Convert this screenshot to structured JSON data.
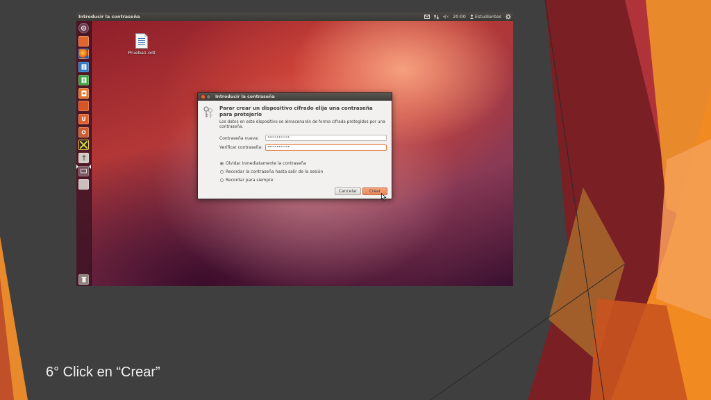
{
  "caption": "6° Click en “Crear”",
  "colors": {
    "accent": "#e98a5e",
    "slide_bg": "#3f3f3f",
    "orange": "#f0821e",
    "red": "#a52a2a"
  },
  "screen": {
    "topbar": {
      "title": "Introducir la contraseña",
      "time": "20:00",
      "user": "Estudiantes",
      "icons": [
        "mail-icon",
        "network-icon",
        "volume-icon",
        "user-icon",
        "gear-icon"
      ]
    },
    "launcher": {
      "items": [
        "dash-icon",
        "files-icon",
        "firefox-icon",
        "writer-icon",
        "calc-icon",
        "impress-icon",
        "software-center-icon",
        "ubuntu-one-icon",
        "settings-icon",
        "game-icon",
        "terminal-icon",
        "monitor-icon",
        "removable-drive-icon",
        "trash-icon"
      ]
    },
    "desktop_file": {
      "name": "Prueba1.odt",
      "icon": "document-icon"
    },
    "dialog": {
      "title": "Introducir la contraseña",
      "heading": "Parar crear un dispositivo cifrado elija una contraseña para protejerlo",
      "description": "Los datos en este dispositivo se almacenarán de forma cifrada protegidos por una contraseña.",
      "new_password_label": "Contraseña nueva:",
      "new_password_value": "••••••••••••",
      "verify_password_label": "Verificar contraseña:",
      "verify_password_value": "••••••••••••",
      "options": [
        {
          "label": "Olvidar inmediatamente la contraseña",
          "selected": true
        },
        {
          "label": "Recordar la contraseña hasta salir de la sesión",
          "selected": false
        },
        {
          "label": "Recordar para siempre",
          "selected": false
        }
      ],
      "cancel_label": "Cancelar",
      "create_label": "Crear"
    }
  }
}
